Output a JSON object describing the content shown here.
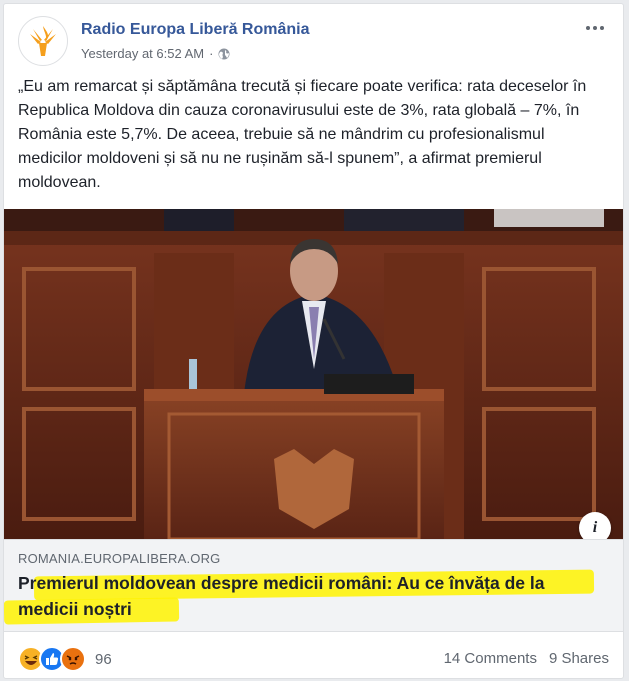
{
  "page": {
    "name": "Radio Europa Liberă România",
    "timestamp": "Yesterday at 6:52 AM",
    "separator": "·",
    "audience_icon": "globe-icon",
    "avatar_icon": "rfe-torch-logo"
  },
  "post": {
    "text": "„Eu am remarcat și săptămâna trecută și fiecare poate verifica: rata deceselor în Republica Moldova din cauza coronavirusului este de 3%, rata globală – 7%, în România este 5,7%. De aceea, trebuie să ne mândrim cu profesionalismul medicilor moldoveni și să nu ne rușinăm să-l spunem”, a afirmat premierul moldovean."
  },
  "link": {
    "domain": "ROMANIA.EUROPALIBERA.ORG",
    "title": "Premierul moldovean despre medicii români: Au ce învăța de la medicii noștri",
    "info_label": "i"
  },
  "footer": {
    "reaction_count": "96",
    "comments": "14 Comments",
    "shares": "9 Shares",
    "reaction_icons": [
      "haha-icon",
      "like-icon",
      "angry-icon"
    ]
  },
  "colors": {
    "page_name": "#365899",
    "highlight": "#fff200",
    "like": "#1877f2",
    "haha": "#f7b125",
    "angry": "#e9710f",
    "logo": "#f59f1c"
  }
}
